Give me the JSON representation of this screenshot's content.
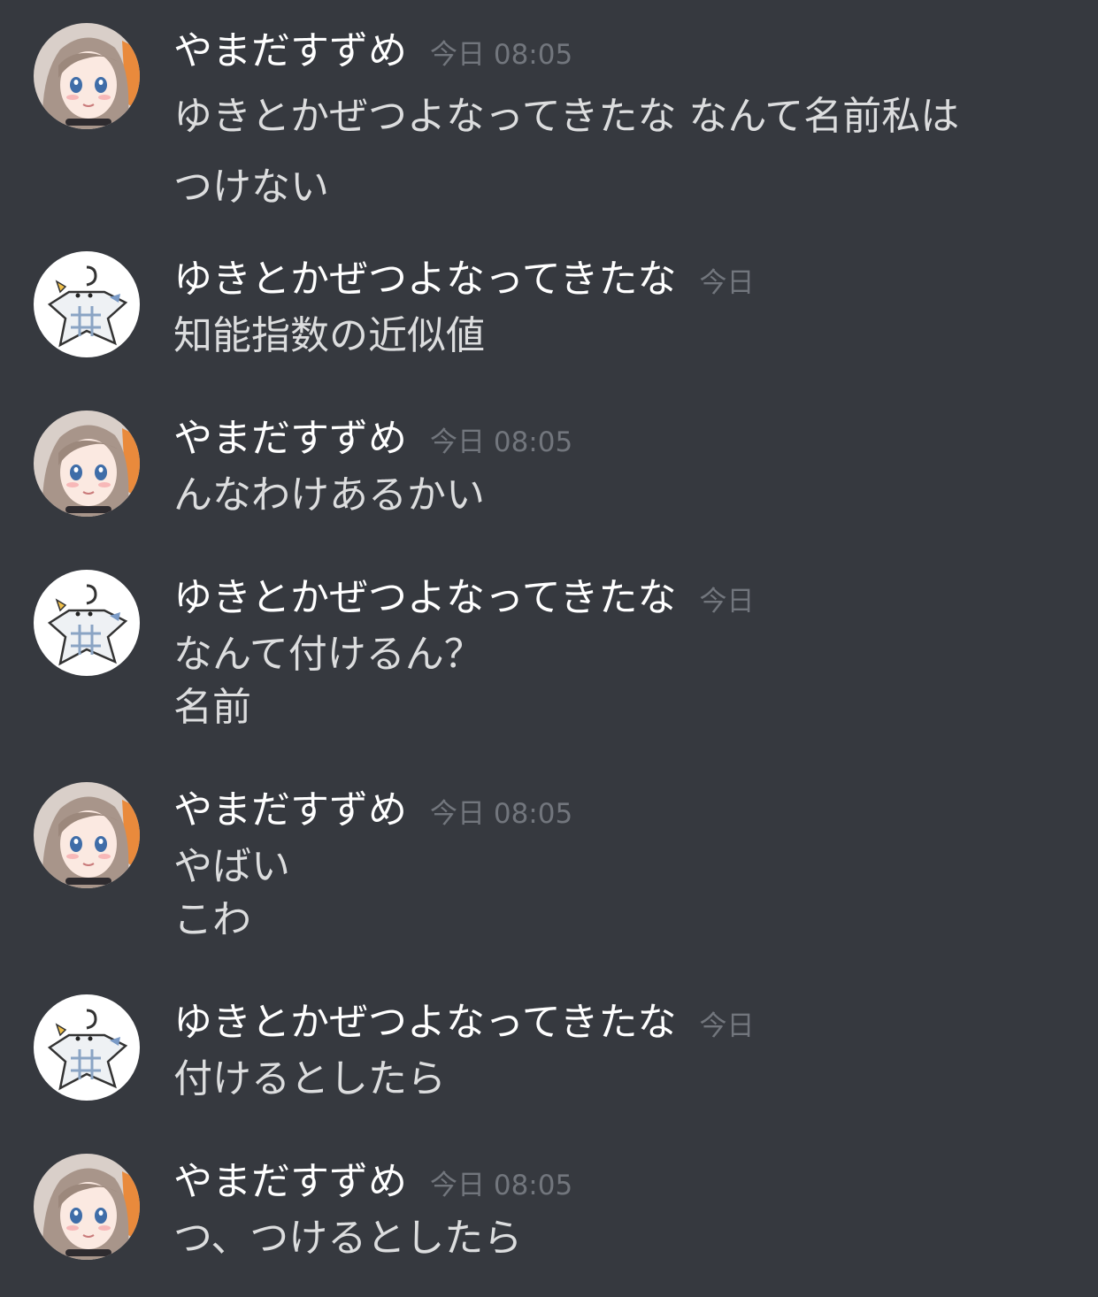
{
  "messages": [
    {
      "author": "やまだすずめ",
      "timestamp": "今日 08:05",
      "avatar": "anime-girl-avatar",
      "lines": [
        "ゆきとかぜつよなってきたな なんて名前私は",
        "つけない"
      ]
    },
    {
      "author": "ゆきとかぜつよなってきたな",
      "timestamp": "今日",
      "avatar": "snowman-star-avatar",
      "lines": [
        "知能指数の近似値"
      ]
    },
    {
      "author": "やまだすずめ",
      "timestamp": "今日 08:05",
      "avatar": "anime-girl-avatar",
      "lines": [
        "んなわけあるかい"
      ]
    },
    {
      "author": "ゆきとかぜつよなってきたな",
      "timestamp": "今日",
      "avatar": "snowman-star-avatar",
      "lines": [
        "なんて付けるん？",
        "名前"
      ]
    },
    {
      "author": "やまだすずめ",
      "timestamp": "今日 08:05",
      "avatar": "anime-girl-avatar",
      "lines": [
        "やばい",
        "こわ"
      ]
    },
    {
      "author": "ゆきとかぜつよなってきたな",
      "timestamp": "今日",
      "avatar": "snowman-star-avatar",
      "lines": [
        "付けるとしたら"
      ]
    },
    {
      "author": "やまだすずめ",
      "timestamp": "今日 08:05",
      "avatar": "anime-girl-avatar",
      "lines": [
        "つ、つけるとしたら"
      ]
    }
  ],
  "colors": {
    "background": "#36393f",
    "username": "#ffffff",
    "message_text": "#dcddde",
    "timestamp": "#72767d"
  }
}
